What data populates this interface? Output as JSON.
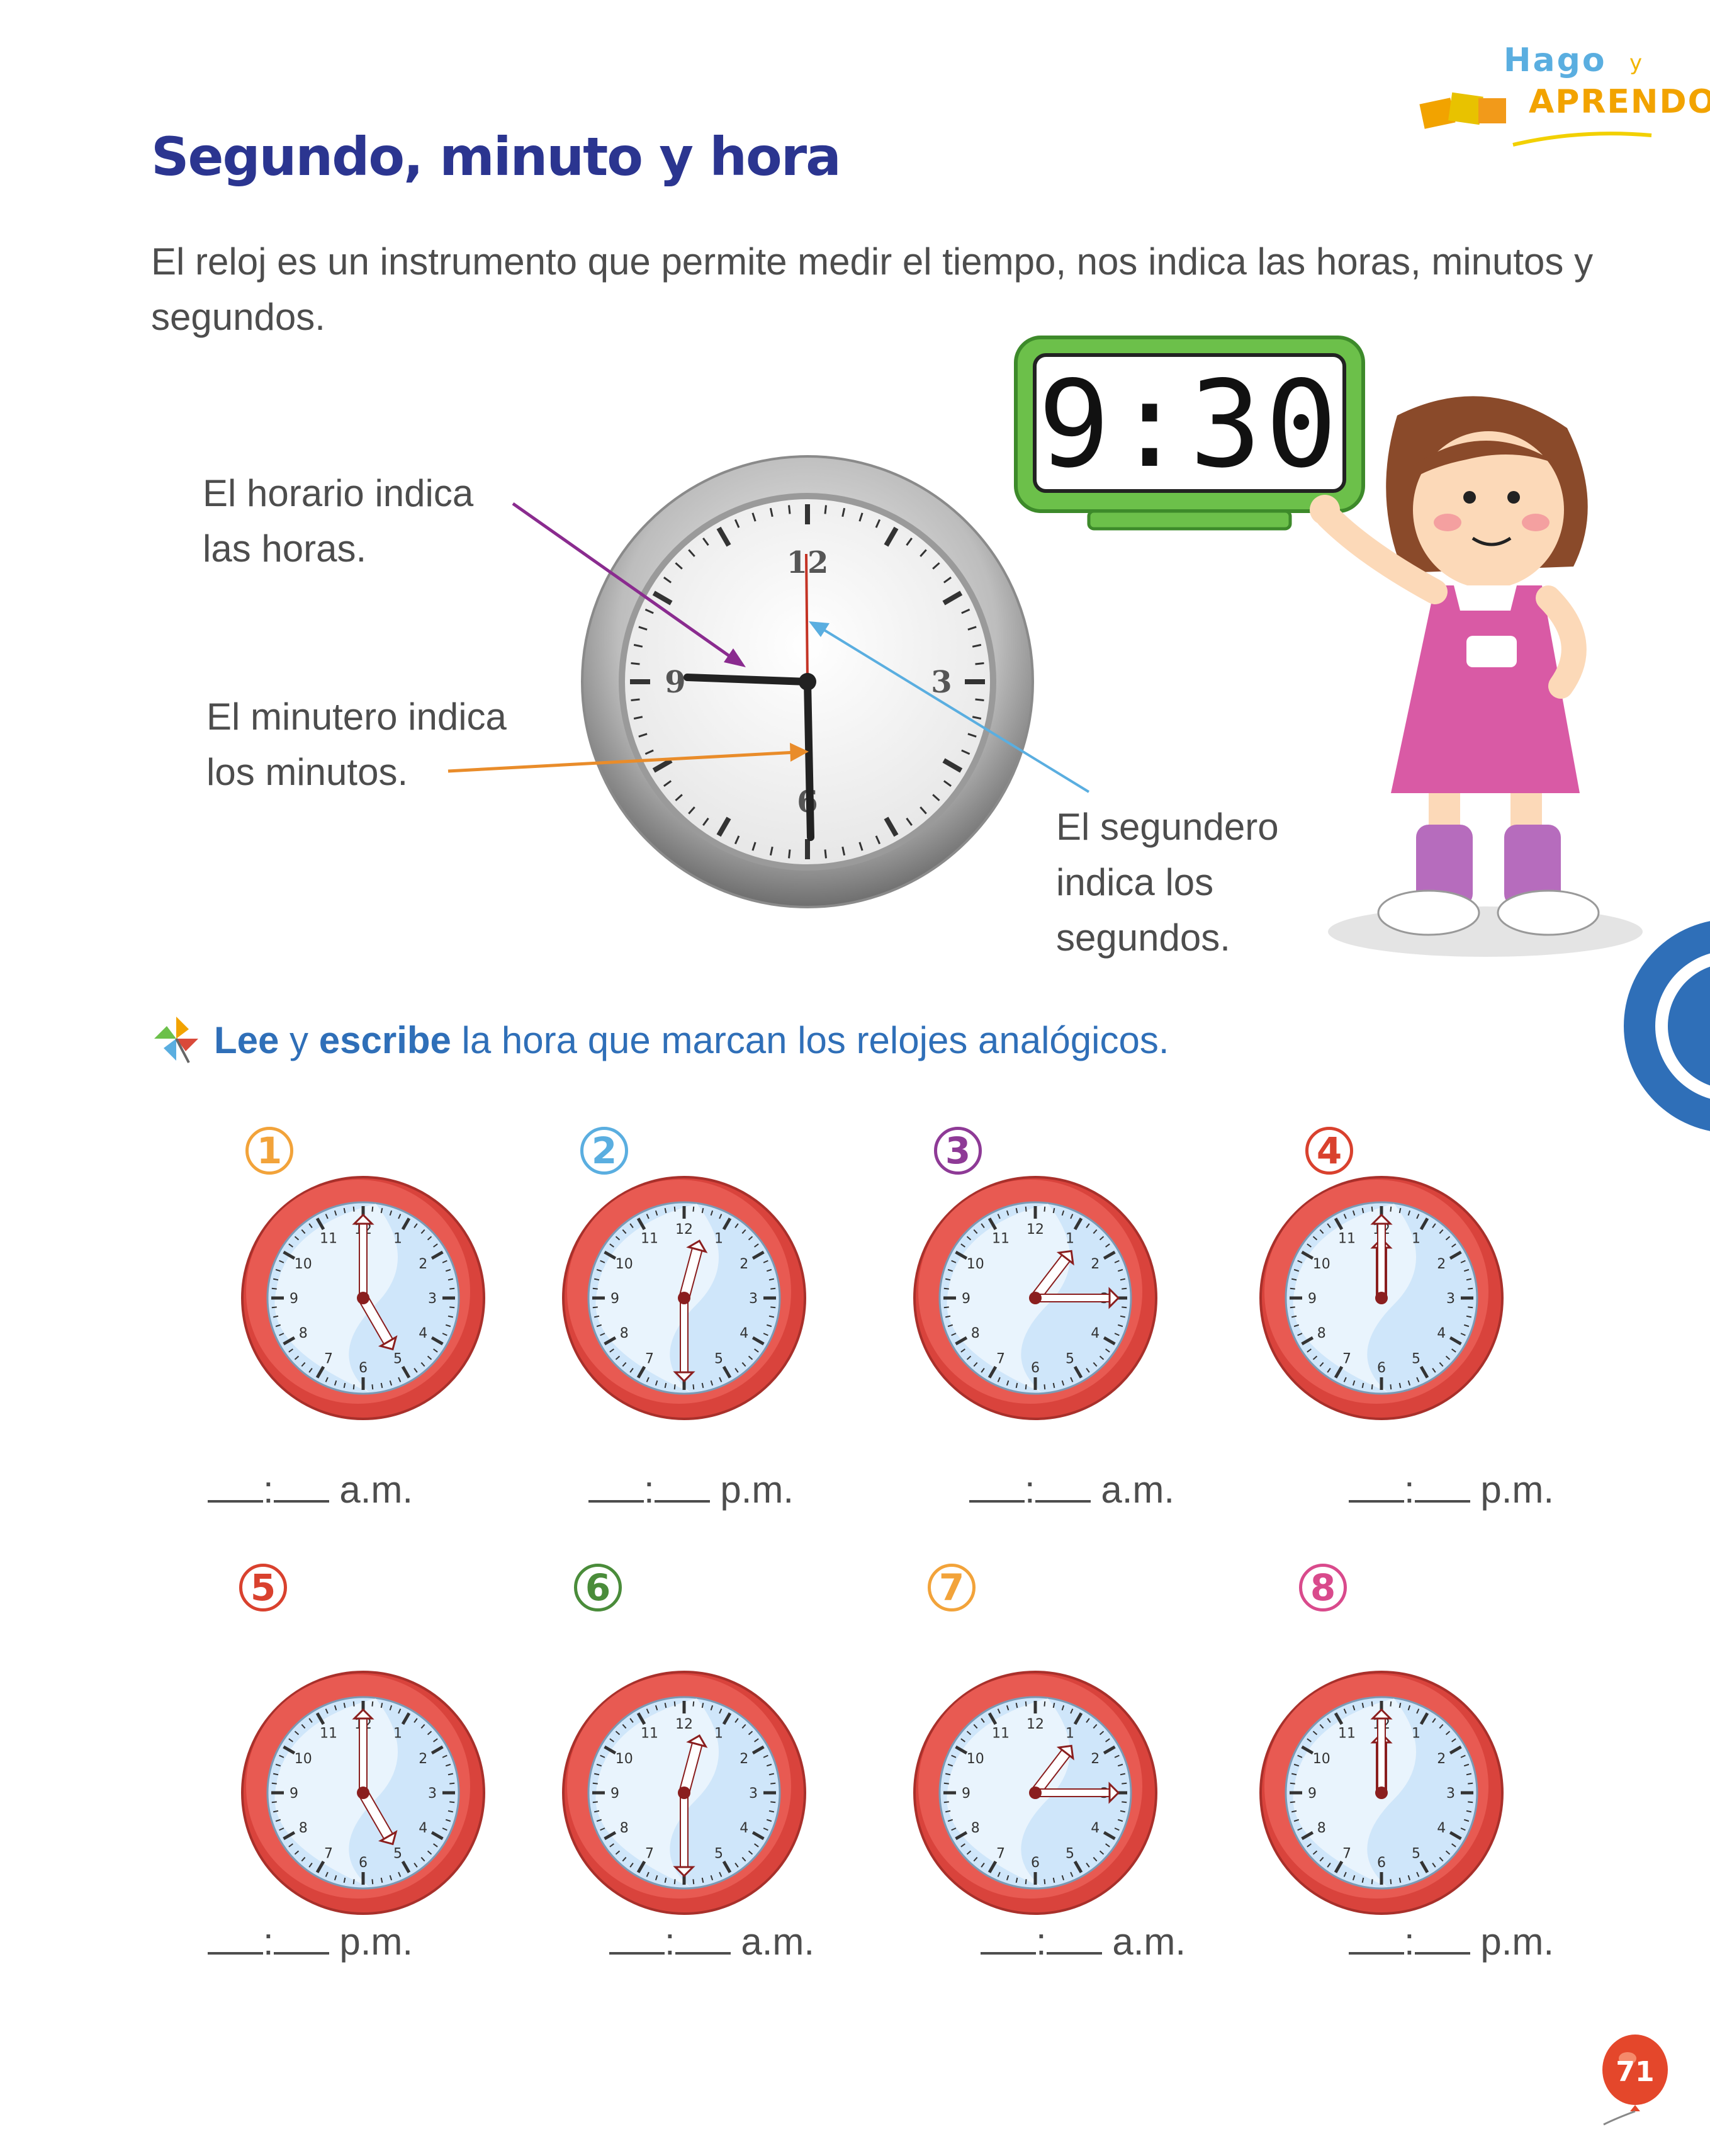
{
  "brand": {
    "line1": "Hago",
    "connector": "y",
    "line2": "APRENDO"
  },
  "title": "Segundo, minuto y hora",
  "intro": "El reloj es un instrumento que permite medir el tiempo, nos indica las horas, minutos y segundos.",
  "digital_clock": {
    "display": "9:30",
    "color": "#6cc04a"
  },
  "labels": {
    "hour_hand": [
      "El horario indica",
      "las horas."
    ],
    "minute_hand": [
      "El minutero indica",
      "los minutos."
    ],
    "second_hand": [
      "El segundero",
      "indica los",
      "segundos."
    ]
  },
  "big_clock_numbers": [
    "12",
    "3",
    "6",
    "9"
  ],
  "instruction": {
    "bold1": "Lee",
    "mid": " y ",
    "bold2": "escribe",
    "rest": " la hora que marcan los relojes analógicos."
  },
  "exercises": [
    {
      "num": "1",
      "color": "#f2a33a",
      "hour": 5,
      "minute": 0,
      "suffix": "a.m."
    },
    {
      "num": "2",
      "color": "#5aaee0",
      "hour": 12,
      "minute": 30,
      "suffix": "p.m."
    },
    {
      "num": "3",
      "color": "#8e3a96",
      "hour": 1,
      "minute": 15,
      "suffix": "a.m."
    },
    {
      "num": "4",
      "color": "#d9412e",
      "hour": 12,
      "minute": 0,
      "suffix": "p.m."
    },
    {
      "num": "5",
      "color": "#d9412e",
      "hour": 5,
      "minute": 0,
      "suffix": "p.m."
    },
    {
      "num": "6",
      "color": "#4a8c3a",
      "hour": 12,
      "minute": 30,
      "suffix": "a.m."
    },
    {
      "num": "7",
      "color": "#f2a33a",
      "hour": 1,
      "minute": 15,
      "suffix": "a.m."
    },
    {
      "num": "8",
      "color": "#d94a8c",
      "hour": 12,
      "minute": 0,
      "suffix": "p.m."
    }
  ],
  "answer_separator": ":",
  "page_number": "71",
  "colors": {
    "title": "#2b3590",
    "instruction": "#2f6fb8",
    "clock_rim": "#d9433c",
    "clock_face": "#cfe6fa"
  }
}
